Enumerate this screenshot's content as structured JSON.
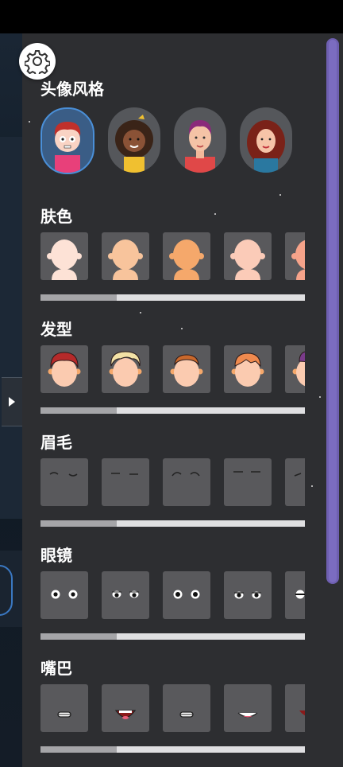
{
  "sections": {
    "avatar_style": {
      "title": "头像风格"
    },
    "skin_color": {
      "title": "肤色",
      "colors": [
        "#fde2d6",
        "#f8c49c",
        "#f5a86b",
        "#fbcbb8",
        "#f6a38a"
      ]
    },
    "hairstyle": {
      "title": "发型",
      "hair_colors": [
        "#b52a2a",
        "#f3e2a6",
        "#c8682c",
        "#f08a4e",
        "#7a3b8a"
      ]
    },
    "eyebrows": {
      "title": "眉毛"
    },
    "glasses": {
      "title": "眼镜"
    },
    "mouth": {
      "title": "嘴巴"
    }
  },
  "colors": {
    "panel": "#2d2e31",
    "tile": "#59595c",
    "accent": "#4a8fd8",
    "scrollbar": "#6e5fb0"
  },
  "icons": {
    "settings": "gear-icon",
    "expand": "triangle-right-icon"
  }
}
